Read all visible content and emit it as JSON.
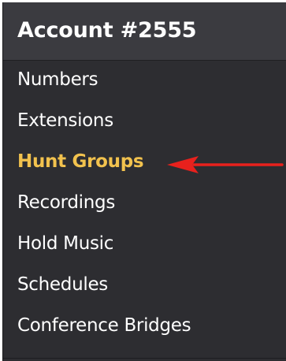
{
  "header": {
    "title": "Account #2555"
  },
  "menu": {
    "items": [
      {
        "label": "Numbers",
        "active": false
      },
      {
        "label": "Extensions",
        "active": false
      },
      {
        "label": "Hunt Groups",
        "active": true
      },
      {
        "label": "Recordings",
        "active": false
      },
      {
        "label": "Hold Music",
        "active": false
      },
      {
        "label": "Schedules",
        "active": false
      },
      {
        "label": "Conference Bridges",
        "active": false
      }
    ]
  },
  "colors": {
    "panel_background": "#2d2d31",
    "header_background": "#3b3b40",
    "text": "#ffffff",
    "active_text": "#f2c24e",
    "arrow": "#e8211d"
  },
  "annotation": {
    "icon": "red-arrow-icon",
    "points_to": "Hunt Groups"
  }
}
